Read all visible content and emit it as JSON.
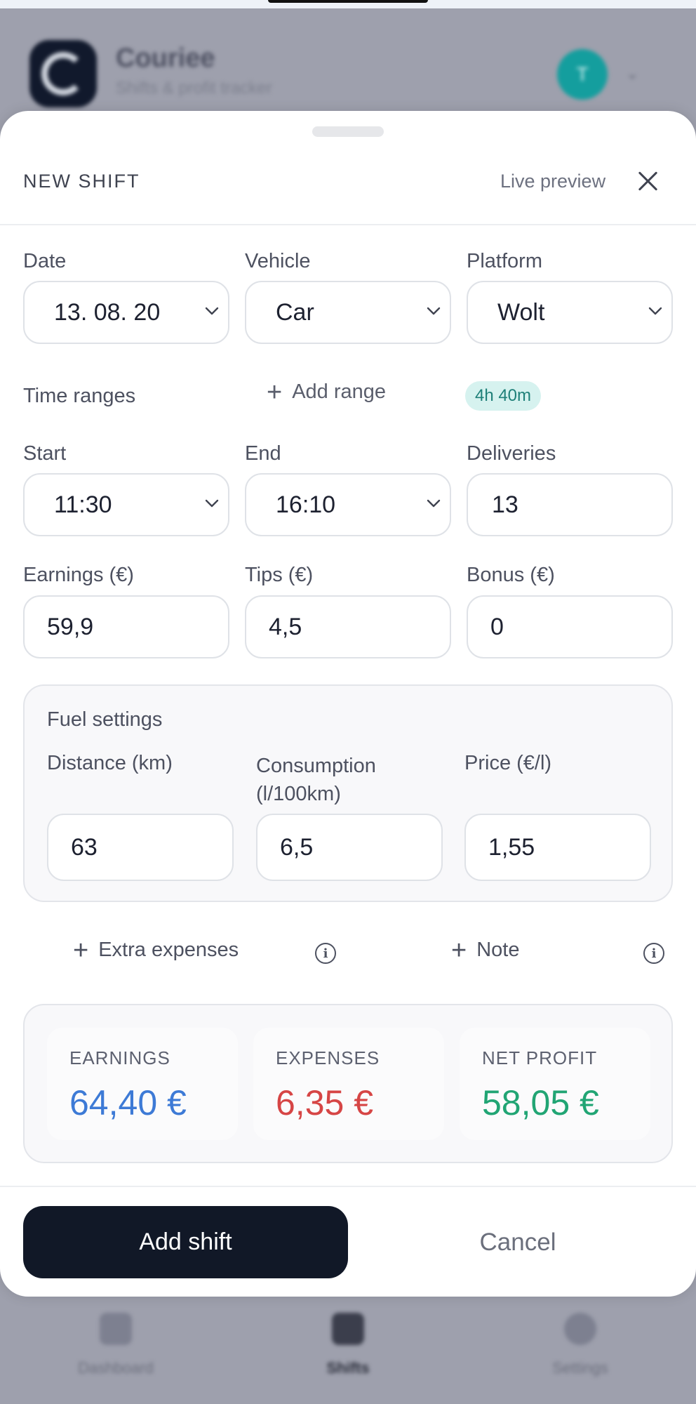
{
  "background_app": {
    "name": "Couriee",
    "subtitle": "Shifts & profit tracker",
    "avatar_initial": "T",
    "nav": [
      {
        "label": "Dashboard"
      },
      {
        "label": "Shifts"
      },
      {
        "label": "Settings"
      }
    ]
  },
  "modal": {
    "title": "NEW SHIFT",
    "preview_label": "Live preview",
    "date": {
      "label": "Date",
      "value": "13. 08. 20"
    },
    "vehicle": {
      "label": "Vehicle",
      "value": "Car"
    },
    "platform": {
      "label": "Platform",
      "value": "Wolt"
    },
    "time_ranges": {
      "label": "Time ranges",
      "add_label": "Add range",
      "duration": "4h 40m"
    },
    "start": {
      "label": "Start",
      "value": "11:30"
    },
    "end": {
      "label": "End",
      "value": "16:10"
    },
    "deliveries": {
      "label": "Deliveries",
      "value": "13"
    },
    "earnings": {
      "label": "Earnings (€)",
      "value": "59,9"
    },
    "tips": {
      "label": "Tips (€)",
      "value": "4,5"
    },
    "bonus": {
      "label": "Bonus (€)",
      "value": "0"
    },
    "fuel": {
      "title": "Fuel settings",
      "distance": {
        "label": "Distance (km)",
        "value": "63"
      },
      "consumption": {
        "label": "Consumption (l/100km)",
        "value": "6,5"
      },
      "price": {
        "label": "Price (€/l)",
        "value": "1,55"
      }
    },
    "extra_expenses_label": "Extra expenses",
    "note_label": "Note",
    "summary": {
      "earnings": {
        "label": "EARNINGS",
        "value": "64,40 €",
        "color": "#3d7ad6"
      },
      "expenses": {
        "label": "EXPENSES",
        "value": "6,35 €",
        "color": "#d64545"
      },
      "net_profit": {
        "label": "NET PROFIT",
        "value": "58,05 €",
        "color": "#21a574"
      }
    },
    "add_button": "Add shift",
    "cancel_button": "Cancel"
  },
  "colors": {
    "primary_button": "#111827",
    "duration_pill_bg": "#d6f2ef",
    "duration_pill_text": "#1f8079"
  }
}
